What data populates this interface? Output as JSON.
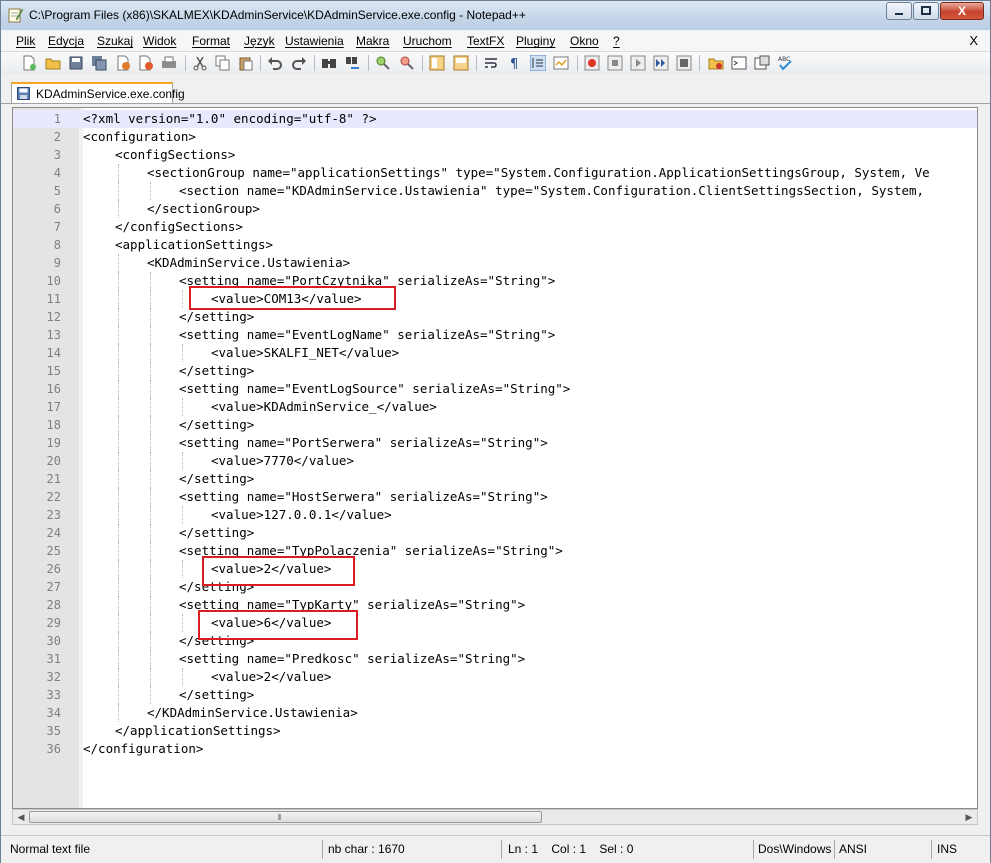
{
  "window": {
    "title": "C:\\Program Files (x86)\\SKALMEX\\KDAdminService\\KDAdminService.exe.config - Notepad++",
    "close_glyph": "X"
  },
  "menu": [
    "Plik",
    "Edycja",
    "Szukaj",
    "Widok",
    "Format",
    "Język",
    "Ustawienia",
    "Makra",
    "Uruchom",
    "TextFX",
    "Pluginy",
    "Okno",
    "?"
  ],
  "menu_close": "X",
  "toolbar_icons": [
    "new-file-icon",
    "open-file-icon",
    "save-icon",
    "save-all-icon",
    "close-icon",
    "close-all-icon",
    "print-icon",
    "cut-icon",
    "copy-icon",
    "paste-icon",
    "undo-icon",
    "redo-icon",
    "find-icon",
    "replace-icon",
    "zoom-in-icon",
    "zoom-out-icon",
    "sync-vertical-icon",
    "sync-horizontal-icon",
    "word-wrap-icon",
    "show-all-chars-icon",
    "indent-guide-icon",
    "doc-map-icon",
    "record-macro-icon",
    "stop-macro-icon",
    "play-macro-icon",
    "run-macro-multiple-icon",
    "save-macro-icon",
    "folder-icon",
    "console-icon",
    "plugin-icon",
    "spellcheck-icon"
  ],
  "tab": {
    "label": "KDAdminService.exe.config"
  },
  "editor": {
    "lines": [
      {
        "n": "1",
        "indent": 0,
        "text": "<?xml version=\"1.0\" encoding=\"utf-8\" ?>"
      },
      {
        "n": "2",
        "indent": 0,
        "text": "<configuration>"
      },
      {
        "n": "3",
        "indent": 1,
        "text": "<configSections>"
      },
      {
        "n": "4",
        "indent": 2,
        "text": "<sectionGroup name=\"applicationSettings\" type=\"System.Configuration.ApplicationSettingsGroup, System, Ve"
      },
      {
        "n": "5",
        "indent": 3,
        "text": "<section name=\"KDAdminService.Ustawienia\" type=\"System.Configuration.ClientSettingsSection, System,"
      },
      {
        "n": "6",
        "indent": 2,
        "text": "</sectionGroup>"
      },
      {
        "n": "7",
        "indent": 1,
        "text": "</configSections>"
      },
      {
        "n": "8",
        "indent": 1,
        "text": "<applicationSettings>"
      },
      {
        "n": "9",
        "indent": 2,
        "text": "<KDAdminService.Ustawienia>"
      },
      {
        "n": "10",
        "indent": 3,
        "text": "<setting name=\"PortCzytnika\" serializeAs=\"String\">"
      },
      {
        "n": "11",
        "indent": 4,
        "text": "<value>COM13</value>"
      },
      {
        "n": "12",
        "indent": 3,
        "text": "</setting>"
      },
      {
        "n": "13",
        "indent": 3,
        "text": "<setting name=\"EventLogName\" serializeAs=\"String\">"
      },
      {
        "n": "14",
        "indent": 4,
        "text": "<value>SKALFI_NET</value>"
      },
      {
        "n": "15",
        "indent": 3,
        "text": "</setting>"
      },
      {
        "n": "16",
        "indent": 3,
        "text": "<setting name=\"EventLogSource\" serializeAs=\"String\">"
      },
      {
        "n": "17",
        "indent": 4,
        "text": "<value>KDAdminService_</value>"
      },
      {
        "n": "18",
        "indent": 3,
        "text": "</setting>"
      },
      {
        "n": "19",
        "indent": 3,
        "text": "<setting name=\"PortSerwera\" serializeAs=\"String\">"
      },
      {
        "n": "20",
        "indent": 4,
        "text": "<value>7770</value>"
      },
      {
        "n": "21",
        "indent": 3,
        "text": "</setting>"
      },
      {
        "n": "22",
        "indent": 3,
        "text": "<setting name=\"HostSerwera\" serializeAs=\"String\">"
      },
      {
        "n": "23",
        "indent": 4,
        "text": "<value>127.0.0.1</value>"
      },
      {
        "n": "24",
        "indent": 3,
        "text": "</setting>"
      },
      {
        "n": "25",
        "indent": 3,
        "text": "<setting name=\"TypPolaczenia\" serializeAs=\"String\">"
      },
      {
        "n": "26",
        "indent": 4,
        "text": "<value>2</value>"
      },
      {
        "n": "27",
        "indent": 3,
        "text": "</setting>"
      },
      {
        "n": "28",
        "indent": 3,
        "text": "<setting name=\"TypKarty\" serializeAs=\"String\">"
      },
      {
        "n": "29",
        "indent": 4,
        "text": "<value>6</value>"
      },
      {
        "n": "30",
        "indent": 3,
        "text": "</setting>"
      },
      {
        "n": "31",
        "indent": 3,
        "text": "<setting name=\"Predkosc\" serializeAs=\"String\">"
      },
      {
        "n": "32",
        "indent": 4,
        "text": "<value>2</value>"
      },
      {
        "n": "33",
        "indent": 3,
        "text": "</setting>"
      },
      {
        "n": "34",
        "indent": 2,
        "text": "</KDAdminService.Ustawienia>"
      },
      {
        "n": "35",
        "indent": 1,
        "text": "</applicationSettings>"
      },
      {
        "n": "36",
        "indent": 0,
        "text": "</configuration>"
      }
    ],
    "current_line": 1,
    "highlighted_lines": [
      11,
      26,
      29
    ]
  },
  "status": {
    "file_type": "Normal text file",
    "nb_char": "nb char : 1670",
    "position": "Ln : 1    Col : 1    Sel : 0",
    "eol": "Dos\\Windows",
    "encoding": "ANSI",
    "mode": "INS"
  }
}
